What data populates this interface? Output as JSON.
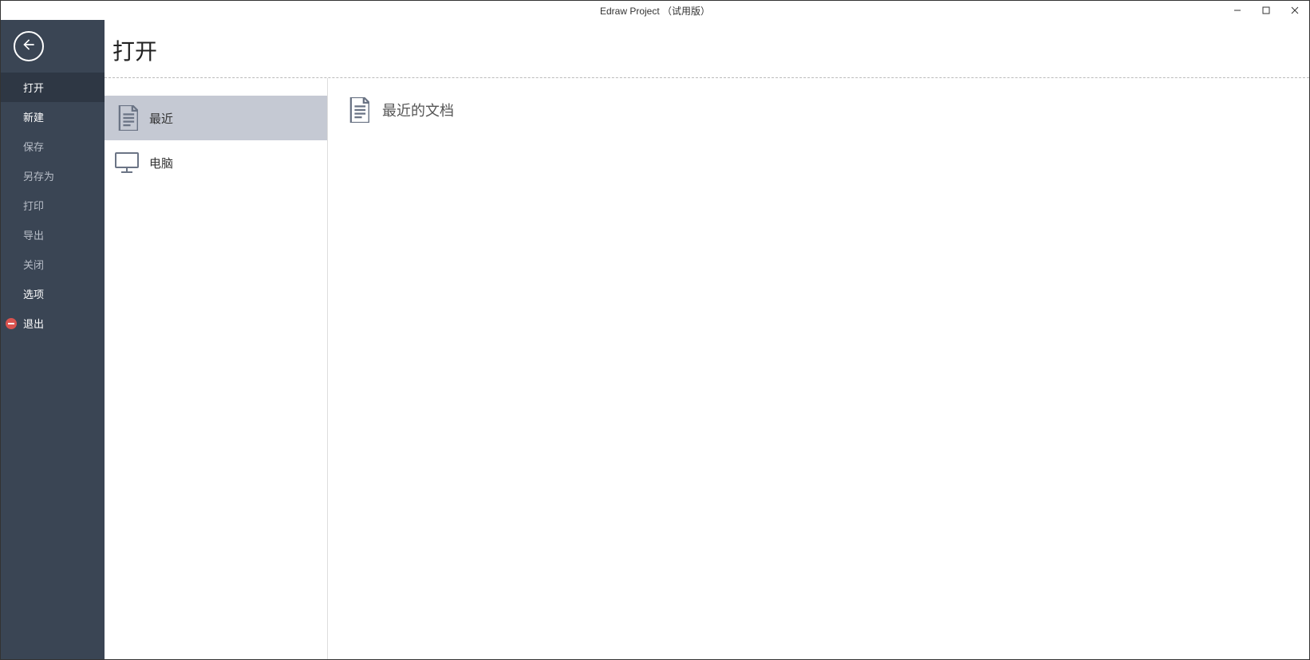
{
  "window": {
    "title": "Edraw Project （试用版）"
  },
  "sidebar": {
    "items": [
      {
        "label": "打开"
      },
      {
        "label": "新建"
      },
      {
        "label": "保存"
      },
      {
        "label": "另存为"
      },
      {
        "label": "打印"
      },
      {
        "label": "导出"
      },
      {
        "label": "关闭"
      },
      {
        "label": "选项"
      },
      {
        "label": "退出"
      }
    ]
  },
  "page": {
    "title": "打开"
  },
  "sources": {
    "recent": "最近",
    "computer": "电脑"
  },
  "detail": {
    "recent_documents": "最近的文档"
  },
  "colors": {
    "sidebar_bg": "#3a4554",
    "sidebar_active": "#2e3744",
    "source_selected": "#c5c9d3",
    "icon_gray": "#6b7485"
  }
}
